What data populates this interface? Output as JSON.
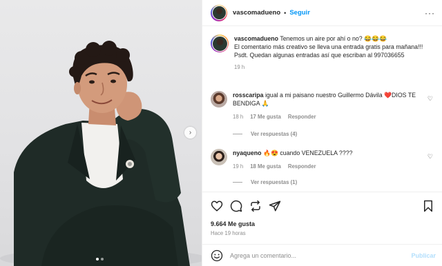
{
  "post": {
    "username": "vascomadueno",
    "separator": "•",
    "follow_label": "Seguir",
    "more_label": "···",
    "next_label": "›"
  },
  "caption": {
    "username": "vascomadueno",
    "line1": "Tenemos un aire por ahí o no? 😂😂😂",
    "line2": "El comentario más creativo se lleva una entrada gratis para mañana!!!",
    "line3": "Psdt. Quedan algunas entradas así que escriban al 997036655",
    "time": "19 h"
  },
  "comments": [
    {
      "username": "rosscaripa",
      "text": "igual a mi paisano nuestro Guillermo Dávila ❤️DIOS TE BENDIGA 🙏",
      "time": "18 h",
      "likes": "17 Me gusta",
      "reply_label": "Responder",
      "view_replies": "Ver respuestas (4)"
    },
    {
      "username": "nyaqueno",
      "text": "🔥😍 cuando VENEZUELA ????",
      "time": "19 h",
      "likes": "18 Me gusta",
      "reply_label": "Responder",
      "view_replies": "Ver respuestas (1)"
    }
  ],
  "stats": {
    "likes": "9.664 Me gusta",
    "time_ago": "Hace 19 horas"
  },
  "composer": {
    "placeholder": "Agrega un comentario...",
    "publish_label": "Publicar"
  },
  "carousel": {
    "slide_count": 2,
    "active_index": 0
  },
  "icons": {
    "like": "heart-icon",
    "comment": "comment-icon",
    "repost": "repost-icon",
    "share": "share-icon",
    "save": "bookmark-icon",
    "emoji": "emoji-icon"
  },
  "colors": {
    "accent": "#0095f6",
    "publish_disabled": "#b2dffc",
    "secondary_text": "#8e8e8e",
    "suit": "#1f2b27"
  }
}
